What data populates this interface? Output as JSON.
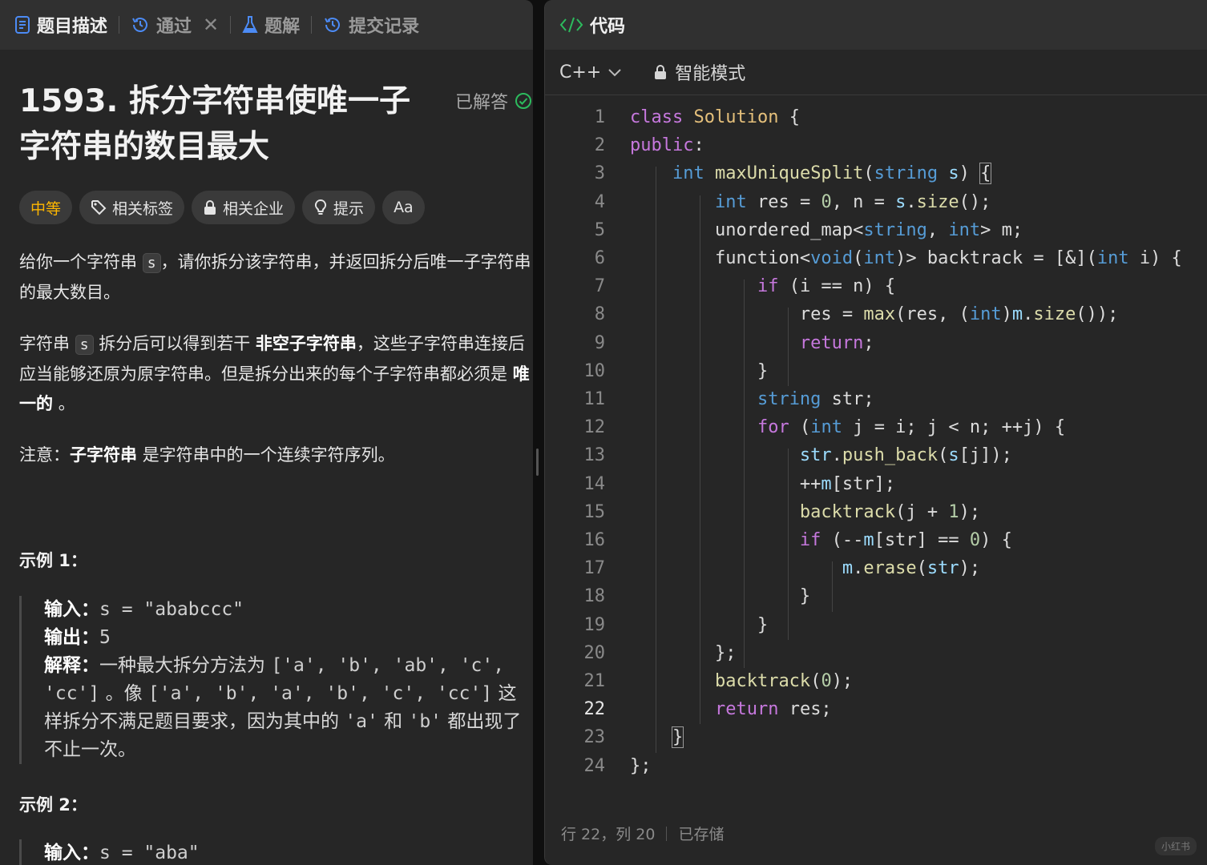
{
  "left_tabs": {
    "description": "题目描述",
    "passed": "通过",
    "solutions": "题解",
    "submissions": "提交记录"
  },
  "problem": {
    "title": "1593. 拆分字符串使唯一子字符串的数目最大",
    "status": "已解答",
    "tags": {
      "difficulty": "中等",
      "related_tags": "相关标签",
      "companies": "相关企业",
      "hint": "提示",
      "translate": "Aa"
    },
    "p1_a": "给你一个字符串",
    "p1_code": "s",
    "p1_b": "，请你拆分该字符串，并返回拆分后唯一子字符串的最大数目。",
    "p2_a": "字符串",
    "p2_code": "s",
    "p2_b": "拆分后可以得到若干",
    "p2_bold1": "非空子字符串",
    "p2_c": "，这些子字符串连接后应当能够还原为原字符串。但是拆分出来的每个子字符串都必须是",
    "p2_bold2": "唯一的",
    "p2_d": "。",
    "p3_a": "注意：",
    "p3_bold": "子字符串",
    "p3_b": "是字符串中的一个连续字符序列。"
  },
  "examples": {
    "ex1_title": "示例 1：",
    "ex1_input_label": "输入：",
    "ex1_input": "s = \"ababccc\"",
    "ex1_output_label": "输出：",
    "ex1_output": "5",
    "ex1_expl_label": "解释：",
    "ex1_expl_a": "一种最大拆分方法为",
    "ex1_expl_list1": "['a', 'b', 'ab', 'c', 'cc']",
    "ex1_expl_b": "。像",
    "ex1_expl_list2": "['a', 'b', 'a', 'b', 'c', 'cc']",
    "ex1_expl_c": "这样拆分不满足题目要求，因为其中的",
    "ex1_expl_q1": "'a'",
    "ex1_expl_d": "和",
    "ex1_expl_q2": "'b'",
    "ex1_expl_e": "都出现了不止一次。",
    "ex2_title": "示例 2：",
    "ex2_input_label": "输入：",
    "ex2_input": "s = \"aba\""
  },
  "code_panel": {
    "title": "代码",
    "language": "C++",
    "mode": "智能模式",
    "status_pos": "行 22，列 20",
    "status_saved": "已存储",
    "watermark": "小红书"
  },
  "code_lines": [
    "class Solution {",
    "public:",
    "    int maxUniqueSplit(string s) {",
    "        int res = 0, n = s.size();",
    "        unordered_map<string, int> m;",
    "        function<void(int)> backtrack = [&](int i) {",
    "            if (i == n) {",
    "                res = max(res, (int)m.size());",
    "                return;",
    "            }",
    "            string str;",
    "            for (int j = i; j < n; ++j) {",
    "                str.push_back(s[j]);",
    "                ++m[str];",
    "                backtrack(j + 1);",
    "                if (--m[str] == 0) {",
    "                    m.erase(str);",
    "                }",
    "            }",
    "        };",
    "        backtrack(0);",
    "        return res;",
    "    }",
    "};"
  ],
  "colors": {
    "accent_blue": "#569cd6",
    "keyword_purple": "#c678dd",
    "class_yellow": "#e5c07b",
    "difficulty_orange": "#ffb700",
    "solved_green": "#2cbb5d"
  }
}
